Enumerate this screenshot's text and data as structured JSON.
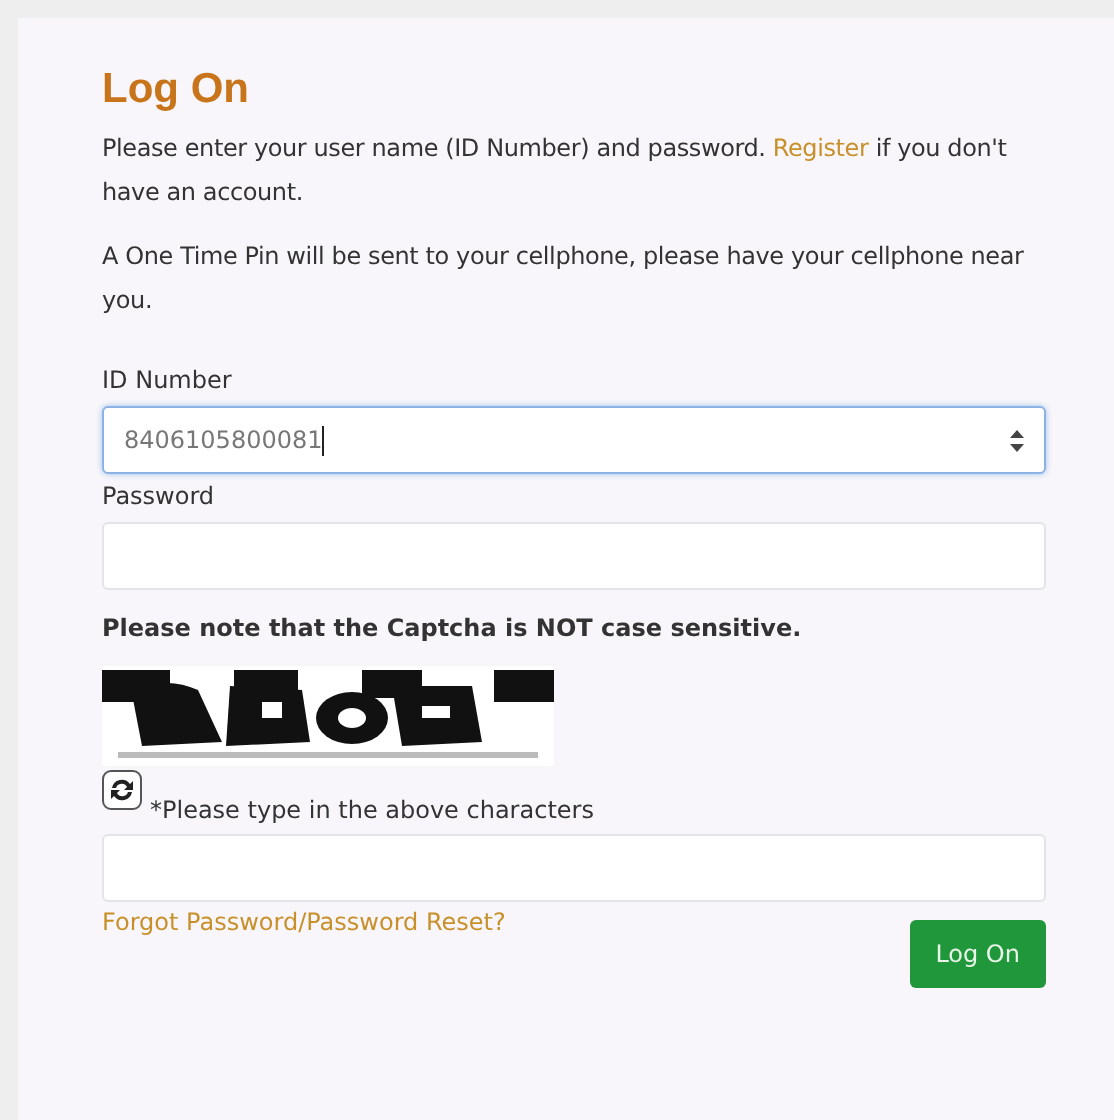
{
  "title": "Log On",
  "intro": {
    "before": "Please enter your user name (ID Number) and password. ",
    "link": "Register",
    "after": " if you don't have an account."
  },
  "otp_note": "A One Time Pin will be sent to your cellphone, please have your cellphone near you.",
  "fields": [
    {
      "kind": "number",
      "label": "ID Number",
      "value": "8406105800081",
      "focused": true
    },
    {
      "kind": "password",
      "label": "Password",
      "focused": false
    }
  ],
  "captcha": {
    "note": "Please note that the Captcha is NOT case sensitive.",
    "prompt": "*Please type in the above characters"
  },
  "forgot_link": "Forgot Password/Password Reset?",
  "submit": "Log On"
}
